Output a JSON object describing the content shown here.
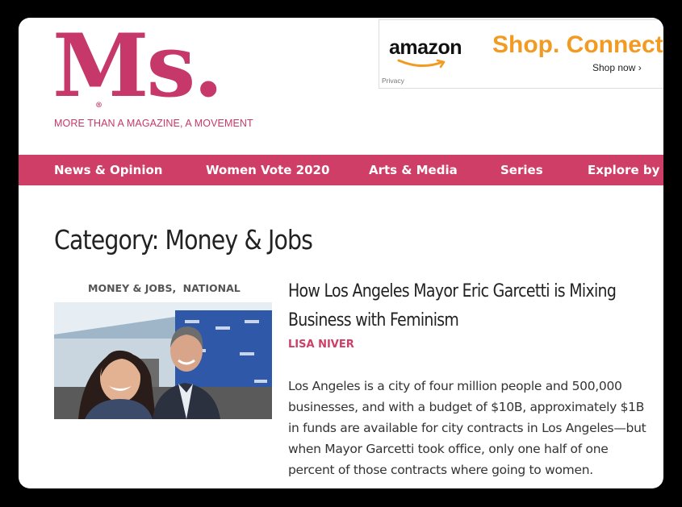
{
  "brand": {
    "logo": "Ms.",
    "registered": "®",
    "tagline": "MORE THAN A MAGAZINE, A MOVEMENT"
  },
  "ad": {
    "brand": "amazon",
    "headline": "Shop. Connect.",
    "cta": "Shop now ›",
    "privacy": "Privacy"
  },
  "nav": {
    "items": [
      "News & Opinion",
      "Women Vote 2020",
      "Arts & Media",
      "Series",
      "Explore by T"
    ]
  },
  "page": {
    "category_title": "Category: Money & Jobs"
  },
  "post": {
    "categories": [
      "MONEY & JOBS,",
      "NATIONAL"
    ],
    "title_lines": [
      "How Los Angeles Mayor Eric Garcetti is Mixing",
      "Business with Feminism"
    ],
    "author": "LISA NIVER",
    "excerpt": "Los Angeles is a city of four million people and 500,000 businesses, and with a budget of $10B, approximately $1B in funds are available for city contracts in Los Angeles—but when Mayor Garcetti took office, only one half of one percent of those contracts where going to women."
  },
  "colors": {
    "brand": "#c7386a",
    "nav_bg": "#cf3e66",
    "ad_orange": "#f29b22"
  }
}
